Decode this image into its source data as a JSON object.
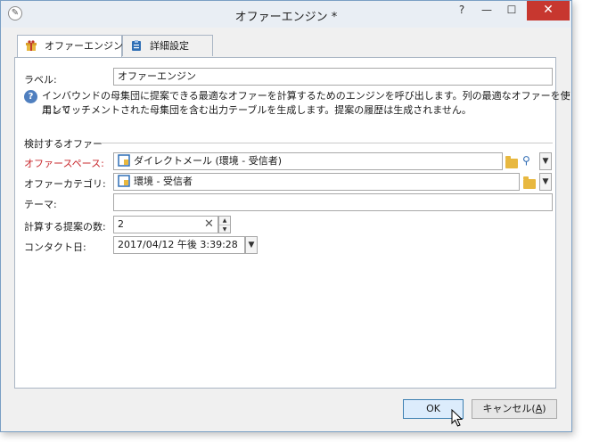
{
  "window": {
    "title": "オファーエンジン *",
    "app_icon": "app-icon",
    "help_label": "?",
    "minimize_label": "—",
    "maximize_label": "☐",
    "close_label": "✕"
  },
  "tabs": [
    {
      "label": "オファーエンジン",
      "icon": "offer-engine-icon",
      "active": true
    },
    {
      "label": "詳細設定",
      "icon": "advanced-settings-icon",
      "active": false
    }
  ],
  "form": {
    "label_caption": "ラベル:",
    "label_value": "オファーエンジン",
    "info_line1": "インバウンドの母集団に提案できる最適なオファーを計算するためのエンジンを呼び出します。列の最適なオファーを使用して",
    "info_line2": "エンリッチメントされた母集団を含む出力テーブルを生成します。提案の履歴は生成されません。",
    "group_title": "検討するオファー",
    "offer_space_caption": "オファースペース:",
    "offer_space_value": "ダイレクトメール (環境 - 受信者)",
    "offer_category_caption": "オファーカテゴリ:",
    "offer_category_value": "環境 - 受信者",
    "theme_caption": "テーマ:",
    "theme_value": "",
    "proposal_count_caption": "計算する提案の数:",
    "proposal_count_value": "2",
    "contact_date_caption": "コンタクト日:",
    "contact_date_value": "2017/04/12 午後 3:39:28"
  },
  "buttons": {
    "ok": "OK",
    "cancel_prefix": "キャンセル(",
    "cancel_key": "A",
    "cancel_suffix": ")"
  },
  "colors": {
    "required_label": "#c8282d",
    "info_icon": "#4f7fbf",
    "close_button": "#c7372f",
    "ok_border": "#3c7fb1"
  }
}
